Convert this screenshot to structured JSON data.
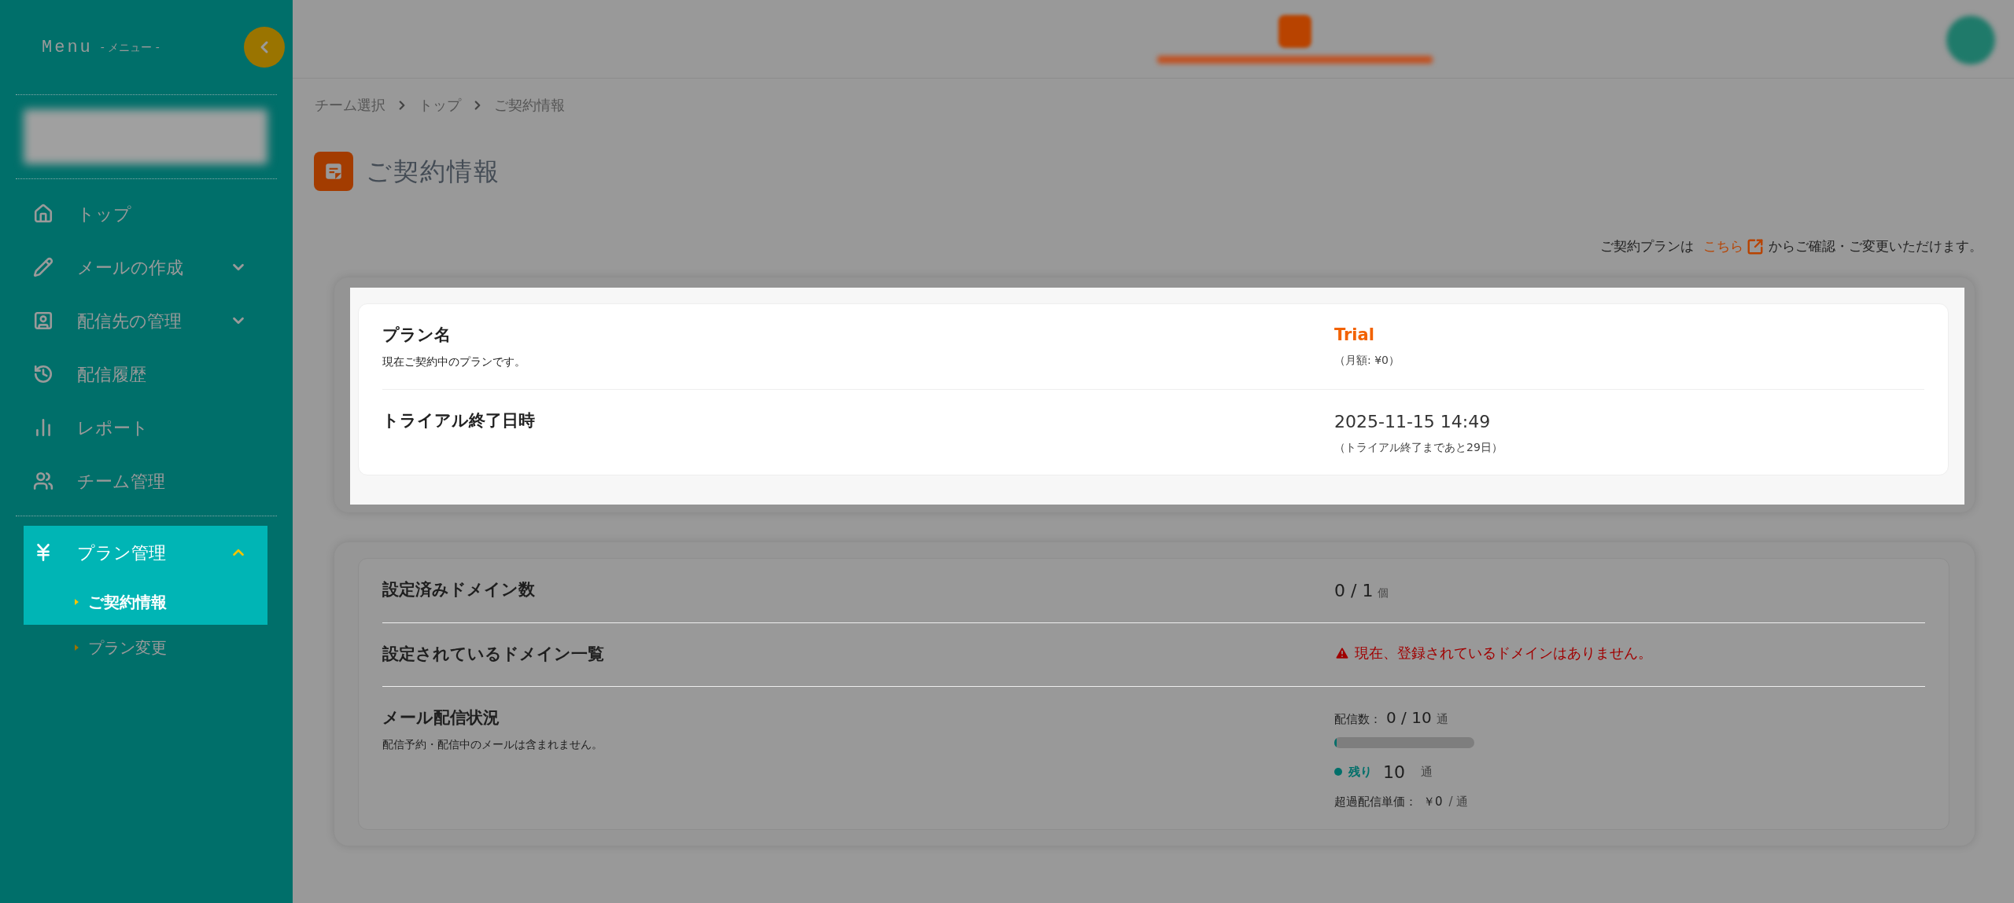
{
  "sidebar": {
    "title": "Menu",
    "subtitle": "- メニュー -",
    "items": [
      {
        "label": "トップ",
        "selected": false
      },
      {
        "label": "メールの作成",
        "selected": false,
        "expanded": false
      },
      {
        "label": "配信先の管理",
        "selected": false,
        "expanded": false
      },
      {
        "label": "配信履歴",
        "selected": false
      },
      {
        "label": "レポート",
        "selected": false
      },
      {
        "label": "チーム管理",
        "selected": false
      },
      {
        "label": "プラン管理",
        "selected": true,
        "expanded": true,
        "children": [
          {
            "label": "ご契約情報",
            "selected": true
          },
          {
            "label": "プラン変更",
            "selected": false
          }
        ]
      }
    ]
  },
  "breadcrumb": [
    "チーム選択",
    "トップ",
    "ご契約情報"
  ],
  "page_title": "ご契約情報",
  "notice": {
    "before": "ご契約プランは",
    "link": "こちら",
    "after": "からご確認・ご変更いただけます。"
  },
  "contract_card": [
    {
      "label": "プラン名",
      "description": "現在ご契約中のプランです。",
      "value": "Trial",
      "note": "（月額: ¥0）",
      "kind": "plan"
    },
    {
      "label": "トライアル終了日時",
      "value": "2025-11-15 14:49",
      "note": "（トライアル終了まであと29日）",
      "kind": "date"
    }
  ],
  "usage_card": {
    "domain_count": {
      "label": "設定済みドメイン数",
      "value": "0 / 1",
      "unit": "個"
    },
    "domain_list": {
      "label": "設定されているドメイン一覧",
      "warning": "現在、登録されているドメインはありません。"
    },
    "delivery": {
      "label": "メール配信状況",
      "description": "配信予約・配信中のメールは含まれません。",
      "sent_label": "配信数：",
      "sent": "0 / 10",
      "sent_unit": "通",
      "level": 0,
      "remaining_label": "残り",
      "remaining": "10",
      "remaining_unit": "通",
      "price_label": "超過配信単価：",
      "price": "￥0",
      "price_unit": "/ 通"
    }
  }
}
